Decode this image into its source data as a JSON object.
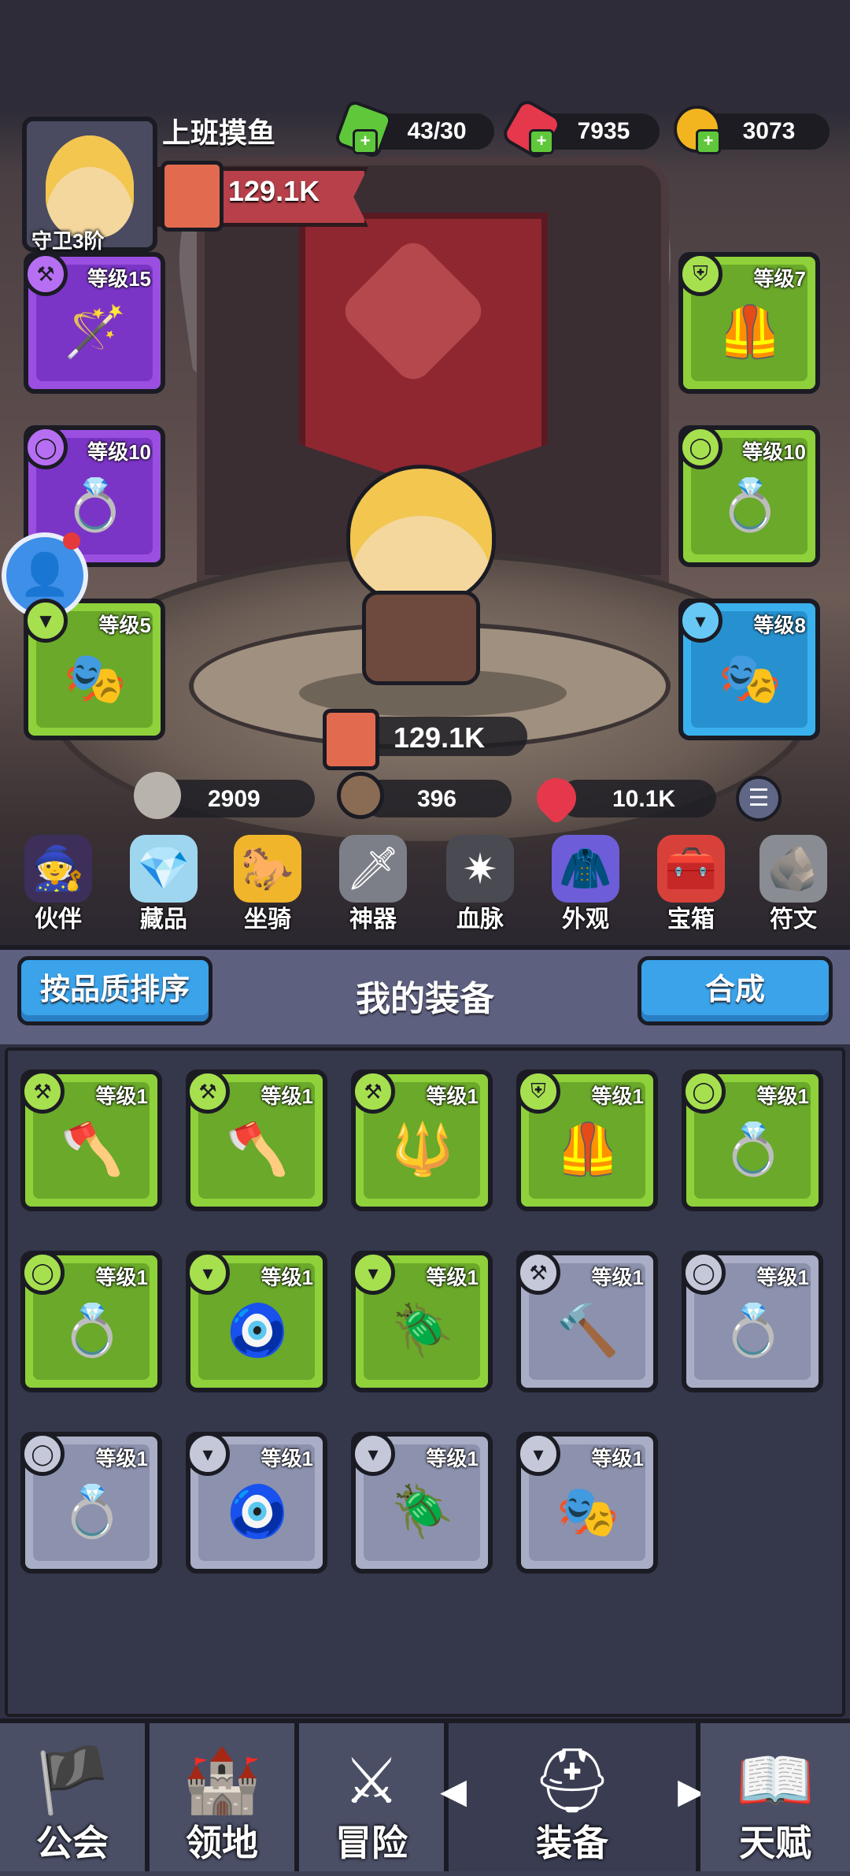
{
  "header": {
    "player_name": "上班摸鱼",
    "rank": "守卫3阶",
    "power": "129.1K"
  },
  "resources": [
    {
      "name": "energy",
      "icon": "green-gem-icon",
      "value": "43/30",
      "color": "#5fc83a"
    },
    {
      "name": "rubies",
      "icon": "red-gem-icon",
      "value": "7935",
      "color": "#e5384c"
    },
    {
      "name": "coins",
      "icon": "gold-coin-icon",
      "value": "3073",
      "color": "#f2b51f"
    }
  ],
  "equipped": {
    "left": [
      {
        "level": "等级15",
        "rarity": "purple",
        "item": "staff"
      },
      {
        "level": "等级10",
        "rarity": "purple",
        "item": "ring"
      },
      {
        "level": "等级5",
        "rarity": "green",
        "item": "mask"
      }
    ],
    "right": [
      {
        "level": "等级7",
        "rarity": "green",
        "item": "armor"
      },
      {
        "level": "等级10",
        "rarity": "green",
        "item": "ring"
      },
      {
        "level": "等级8",
        "rarity": "blue",
        "item": "mask"
      }
    ]
  },
  "hero": {
    "power": "129.1K",
    "attack": "2909",
    "defense": "396",
    "hp": "10.1K"
  },
  "categories": [
    "伙伴",
    "藏品",
    "坐骑",
    "神器",
    "血脉",
    "外观",
    "宝箱",
    "符文"
  ],
  "toolbar": {
    "sort_label": "按品质排序",
    "title": "我的装备",
    "merge_label": "合成"
  },
  "inventory": [
    {
      "level": "等级1",
      "rarity": "green",
      "item": "axe"
    },
    {
      "level": "等级1",
      "rarity": "green",
      "item": "axe"
    },
    {
      "level": "等级1",
      "rarity": "green",
      "item": "spear"
    },
    {
      "level": "等级1",
      "rarity": "green",
      "item": "armor"
    },
    {
      "level": "等级1",
      "rarity": "green",
      "item": "ring"
    },
    {
      "level": "等级1",
      "rarity": "green",
      "item": "ring"
    },
    {
      "level": "等级1",
      "rarity": "green",
      "item": "amulet"
    },
    {
      "level": "等级1",
      "rarity": "green",
      "item": "amulet"
    },
    {
      "level": "等级1",
      "rarity": "gray",
      "item": "hammer"
    },
    {
      "level": "等级1",
      "rarity": "gray",
      "item": "ring"
    },
    {
      "level": "等级1",
      "rarity": "gray",
      "item": "ring"
    },
    {
      "level": "等级1",
      "rarity": "gray",
      "item": "amulet"
    },
    {
      "level": "等级1",
      "rarity": "gray",
      "item": "amulet"
    },
    {
      "level": "等级1",
      "rarity": "gray",
      "item": "mask"
    }
  ],
  "bottom_nav": [
    {
      "label": "公会",
      "icon": "guild-banner-icon"
    },
    {
      "label": "领地",
      "icon": "castle-icon"
    },
    {
      "label": "冒险",
      "icon": "crossed-axes-icon"
    },
    {
      "label": "装备",
      "icon": "helmet-icon",
      "active": true
    },
    {
      "label": "天赋",
      "icon": "talent-book-icon"
    }
  ]
}
